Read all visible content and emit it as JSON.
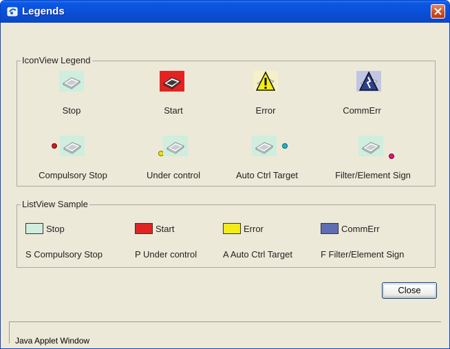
{
  "window": {
    "title": "Legends",
    "close_label": "Close",
    "status": "Java Applet Window"
  },
  "colors": {
    "stop": "#cfeedd",
    "start": "#e32222",
    "error": "#f3ec16",
    "commerr": "#5e6eb6",
    "dot_red": "#cf1919",
    "dot_yellow": "#efe400",
    "dot_blue": "#1eb2d4",
    "dot_magenta": "#e0137c"
  },
  "icon_view": {
    "title": "IconView Legend",
    "items": [
      {
        "label": "Stop",
        "icon": "unit-stop-icon"
      },
      {
        "label": "Start",
        "icon": "unit-start-icon"
      },
      {
        "label": "Error",
        "icon": "unit-error-icon"
      },
      {
        "label": "CommErr",
        "icon": "unit-commerr-icon"
      },
      {
        "label": "Compulsory Stop",
        "icon": "unit-compulsory-stop-icon"
      },
      {
        "label": "Under control",
        "icon": "unit-under-control-icon"
      },
      {
        "label": "Auto Ctrl Target",
        "icon": "unit-auto-ctrl-icon"
      },
      {
        "label": "Filter/Element Sign",
        "icon": "unit-filter-sign-icon"
      }
    ]
  },
  "list_view": {
    "title": "ListView Sample",
    "colors": [
      {
        "label": "Stop"
      },
      {
        "label": "Start"
      },
      {
        "label": "Error"
      },
      {
        "label": "CommErr"
      }
    ],
    "codes": [
      {
        "label": "S Compulsory Stop"
      },
      {
        "label": "P Under control"
      },
      {
        "label": "A Auto Ctrl Target"
      },
      {
        "label": "F Filter/Element Sign"
      }
    ]
  }
}
